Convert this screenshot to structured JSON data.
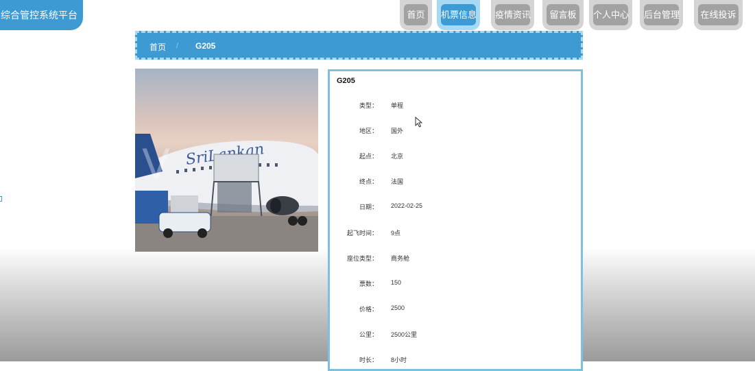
{
  "site": {
    "title": "综合管控系统平台"
  },
  "nav": [
    {
      "label": "首页",
      "active": false
    },
    {
      "label": "机票信息",
      "active": true
    },
    {
      "label": "疫情资讯",
      "active": false
    },
    {
      "label": "留言板",
      "active": false
    },
    {
      "label": "个人中心",
      "active": false
    },
    {
      "label": "后台管理",
      "active": false
    },
    {
      "label": "在线投诉",
      "active": false
    }
  ],
  "breadcrumb": {
    "home": "首页",
    "separator": "/",
    "current": "G205"
  },
  "detail": {
    "title": "G205",
    "fields": [
      {
        "label": "类型：",
        "value": "单程"
      },
      {
        "label": "地区：",
        "value": "国外"
      },
      {
        "label": "起点：",
        "value": "北京"
      },
      {
        "label": "终点：",
        "value": "法国"
      },
      {
        "label": "日期：",
        "value": "2022-02-25"
      },
      {
        "label": "起飞时间：",
        "value": "9点"
      },
      {
        "label": "座位类型：",
        "value": "商务舱"
      },
      {
        "label": "票数：",
        "value": "150"
      },
      {
        "label": "价格：",
        "value": "2500"
      },
      {
        "label": "公里：",
        "value": "2500公里"
      },
      {
        "label": "时长：",
        "value": "8小时"
      }
    ]
  },
  "photo": {
    "airline_text": "SriLankan"
  },
  "colors": {
    "accent": "#3d9ad3",
    "accent_light": "#a7d9f4",
    "tab_gray": "#a2a2a2"
  }
}
